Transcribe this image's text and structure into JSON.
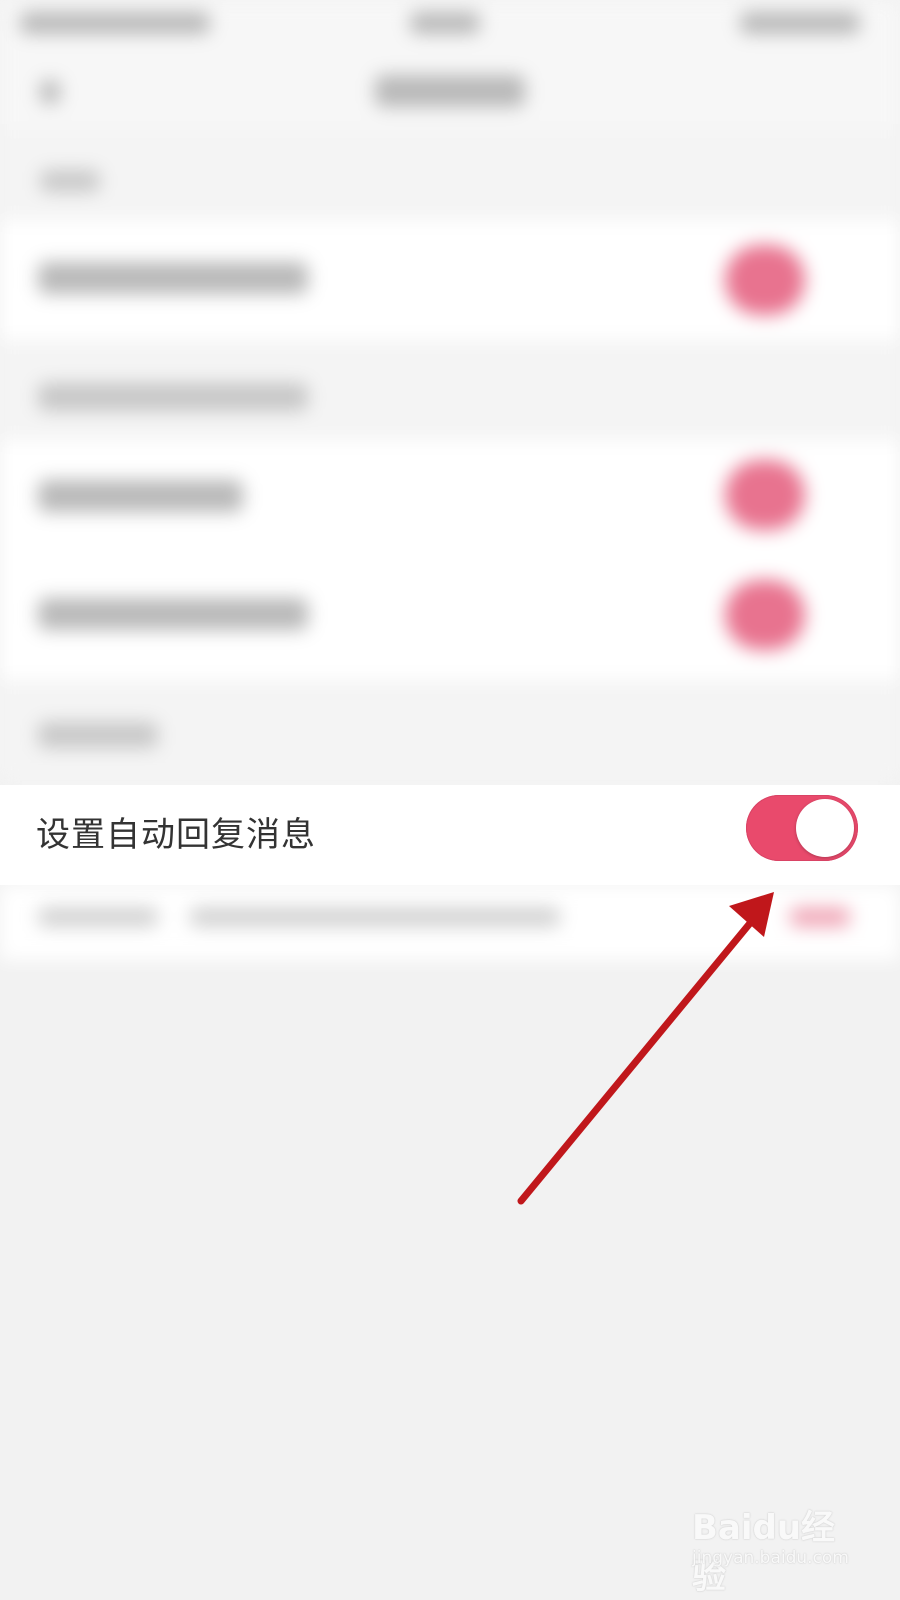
{
  "setting": {
    "label": "设置自动回复消息",
    "toggle_on": true,
    "toggle_color": "#e94a6c"
  },
  "annotation": {
    "arrow_color": "#c0171b"
  },
  "watermark": {
    "logo_text": "Baidu经验",
    "url_text": "jingyan.baidu.com"
  }
}
